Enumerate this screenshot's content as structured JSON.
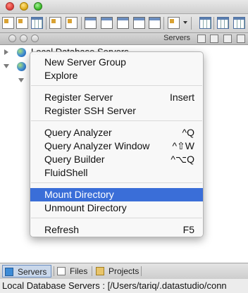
{
  "panel": {
    "title": "Servers"
  },
  "tree": {
    "root_label": "Local Database Servers"
  },
  "menu": {
    "items": [
      {
        "label": "New Server Group",
        "shortcut": ""
      },
      {
        "label": "Explore",
        "shortcut": ""
      },
      {
        "label": "Register Server",
        "shortcut": "Insert"
      },
      {
        "label": "Register SSH Server",
        "shortcut": ""
      },
      {
        "label": "Query Analyzer",
        "shortcut": "^Q"
      },
      {
        "label": "Query Analyzer Window",
        "shortcut": "^⇧W"
      },
      {
        "label": "Query Builder",
        "shortcut": "^⌥Q"
      },
      {
        "label": "FluidShell",
        "shortcut": ""
      },
      {
        "label": "Mount Directory",
        "shortcut": "",
        "selected": true
      },
      {
        "label": "Unmount Directory",
        "shortcut": ""
      },
      {
        "label": "Refresh",
        "shortcut": "F5"
      }
    ]
  },
  "tabs": [
    {
      "label": "Servers",
      "active": true
    },
    {
      "label": "Files",
      "active": false
    },
    {
      "label": "Projects",
      "active": false
    }
  ],
  "status": {
    "text": "Local Database Servers : [/Users/tariq/.datastudio/conn"
  },
  "colors": {
    "selection": "#3a6ed8",
    "active_tab": "#c9d7ea"
  }
}
